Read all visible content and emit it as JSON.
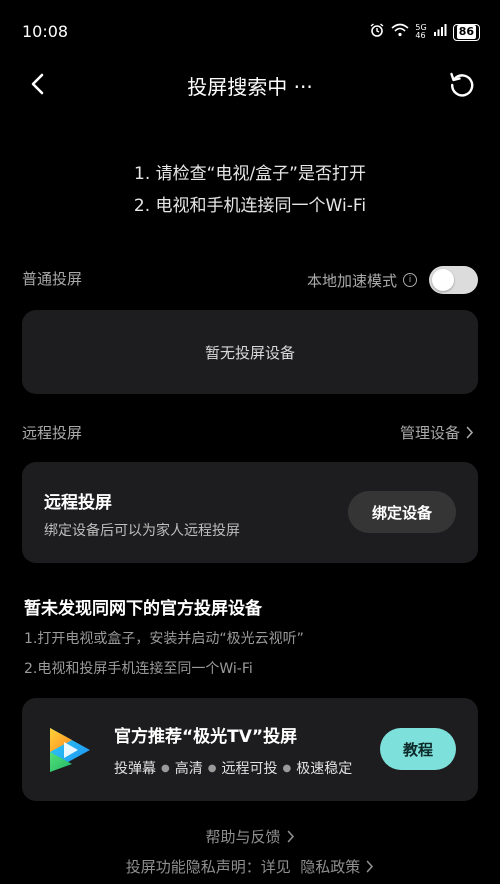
{
  "status_bar": {
    "time": "10:08",
    "network_top": "5G",
    "network_bottom": "46",
    "battery": "86"
  },
  "nav": {
    "title": "投屏搜索中 ···"
  },
  "hints": {
    "line1": "1. 请检查“电视/盒子”是否打开",
    "line2": "2. 电视和手机连接同一个Wi-Fi"
  },
  "local_section": {
    "label": "普通投屏",
    "mode_label": "本地加速模式",
    "toggle_on": false,
    "empty_text": "暂无投屏设备"
  },
  "remote_section": {
    "label": "远程投屏",
    "manage_label": "管理设备",
    "card_title": "远程投屏",
    "card_desc": "绑定设备后可以为家人远程投屏",
    "bind_button": "绑定设备"
  },
  "notice": {
    "title": "暂未发现同网下的官方投屏设备",
    "line1": "1.打开电视或盒子，安装并启动“极光云视听”",
    "line2": "2.电视和投屏手机连接至同一个Wi-Fi"
  },
  "promo": {
    "title": "官方推荐“极光TV”投屏",
    "features": [
      "投弹幕",
      "高清",
      "远程可投",
      "极速稳定"
    ],
    "button": "教程"
  },
  "footer": {
    "help": "帮助与反馈",
    "privacy": "投屏功能隐私声明：详见  隐私政策"
  },
  "colors": {
    "background": "#000000",
    "card": "#1d1d1f",
    "accent": "#7ee0da"
  }
}
